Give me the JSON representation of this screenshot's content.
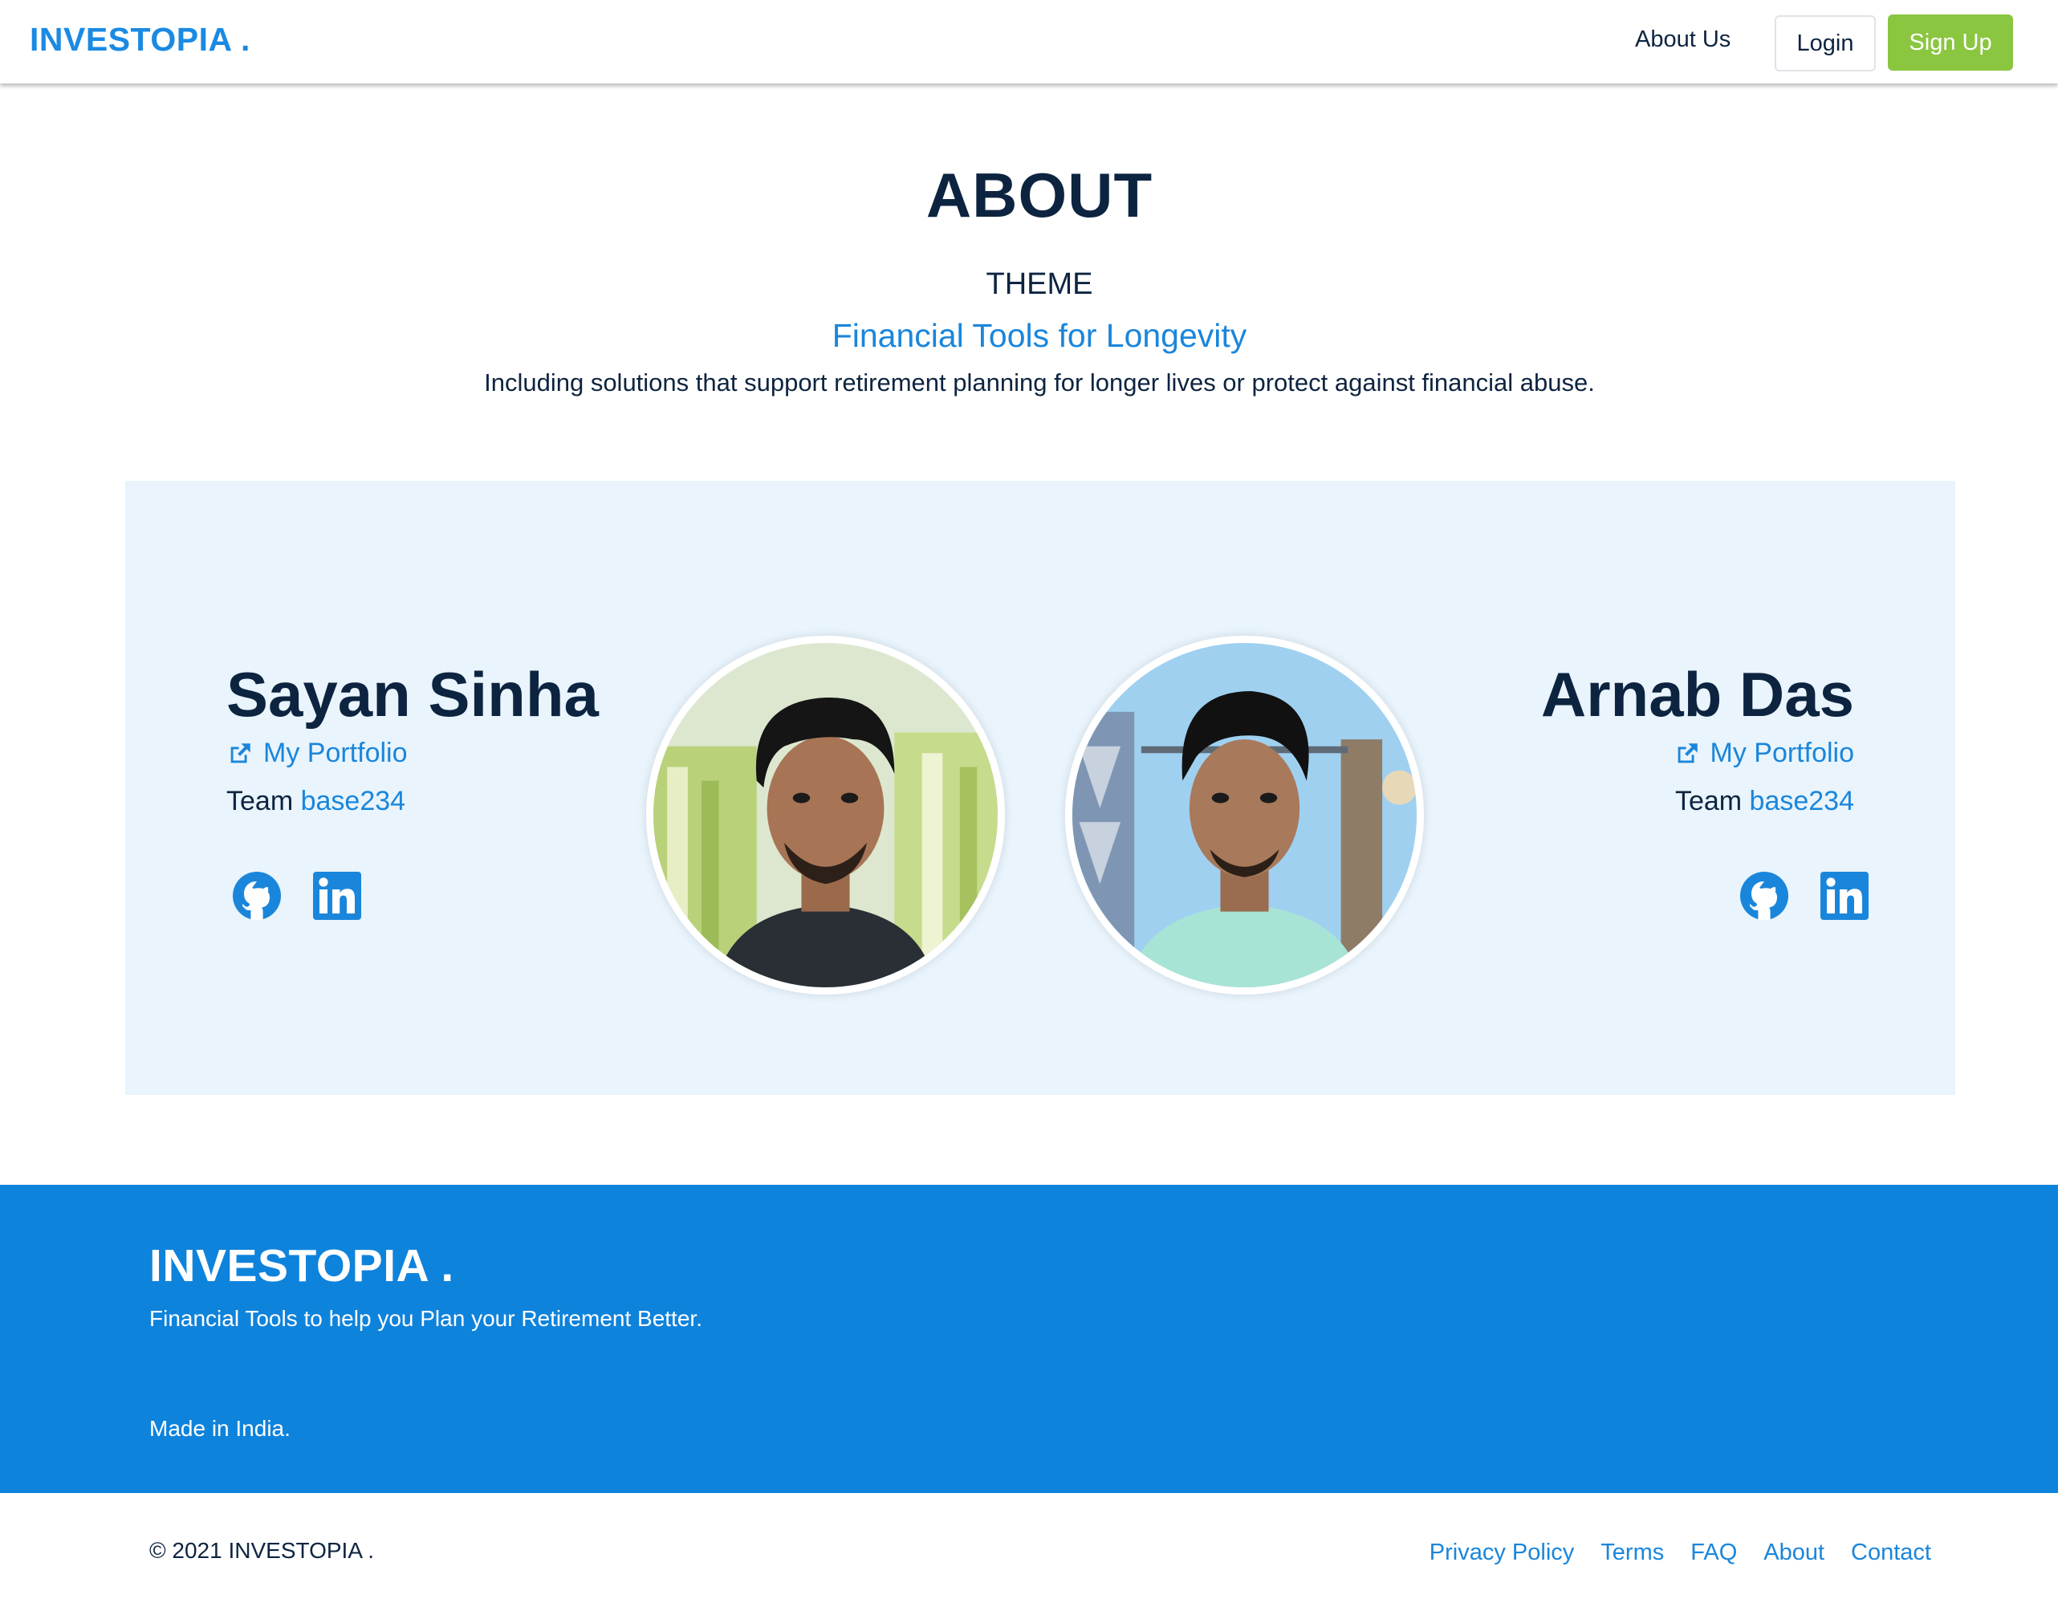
{
  "navbar": {
    "brand": "INVESTOPIA .",
    "about_link": "About Us",
    "login_label": "Login",
    "signup_label": "Sign Up"
  },
  "hero": {
    "title": "ABOUT",
    "theme_label": "THEME",
    "theme_title": "Financial Tools for Longevity",
    "theme_description": "Including solutions that support retirement planning for longer lives or protect against financial abuse."
  },
  "team": {
    "members": [
      {
        "name": "Sayan Sinha",
        "portfolio_label": "My Portfolio",
        "team_prefix": "Team",
        "team_code": "base234",
        "social_icons": [
          "github-icon",
          "linkedin-icon"
        ]
      },
      {
        "name": "Arnab Das",
        "portfolio_label": "My Portfolio",
        "team_prefix": "Team",
        "team_code": "base234",
        "social_icons": [
          "github-icon",
          "linkedin-icon"
        ]
      }
    ]
  },
  "footer": {
    "brand": "INVESTOPIA .",
    "tagline": "Financial Tools to help you Plan your Retirement Better.",
    "made_in": "Made in India.",
    "copyright": "© 2021 INVESTOPIA .",
    "links": [
      "Privacy Policy",
      "Terms",
      "FAQ",
      "About",
      "Contact"
    ]
  },
  "colors": {
    "brand_blue": "#1a8ae3",
    "link_blue": "#1a86db",
    "signup_green": "#8bc640",
    "panel_bg": "#e9f4fc",
    "footer_bg": "#0e83dc",
    "text_dark": "#0d2440"
  }
}
